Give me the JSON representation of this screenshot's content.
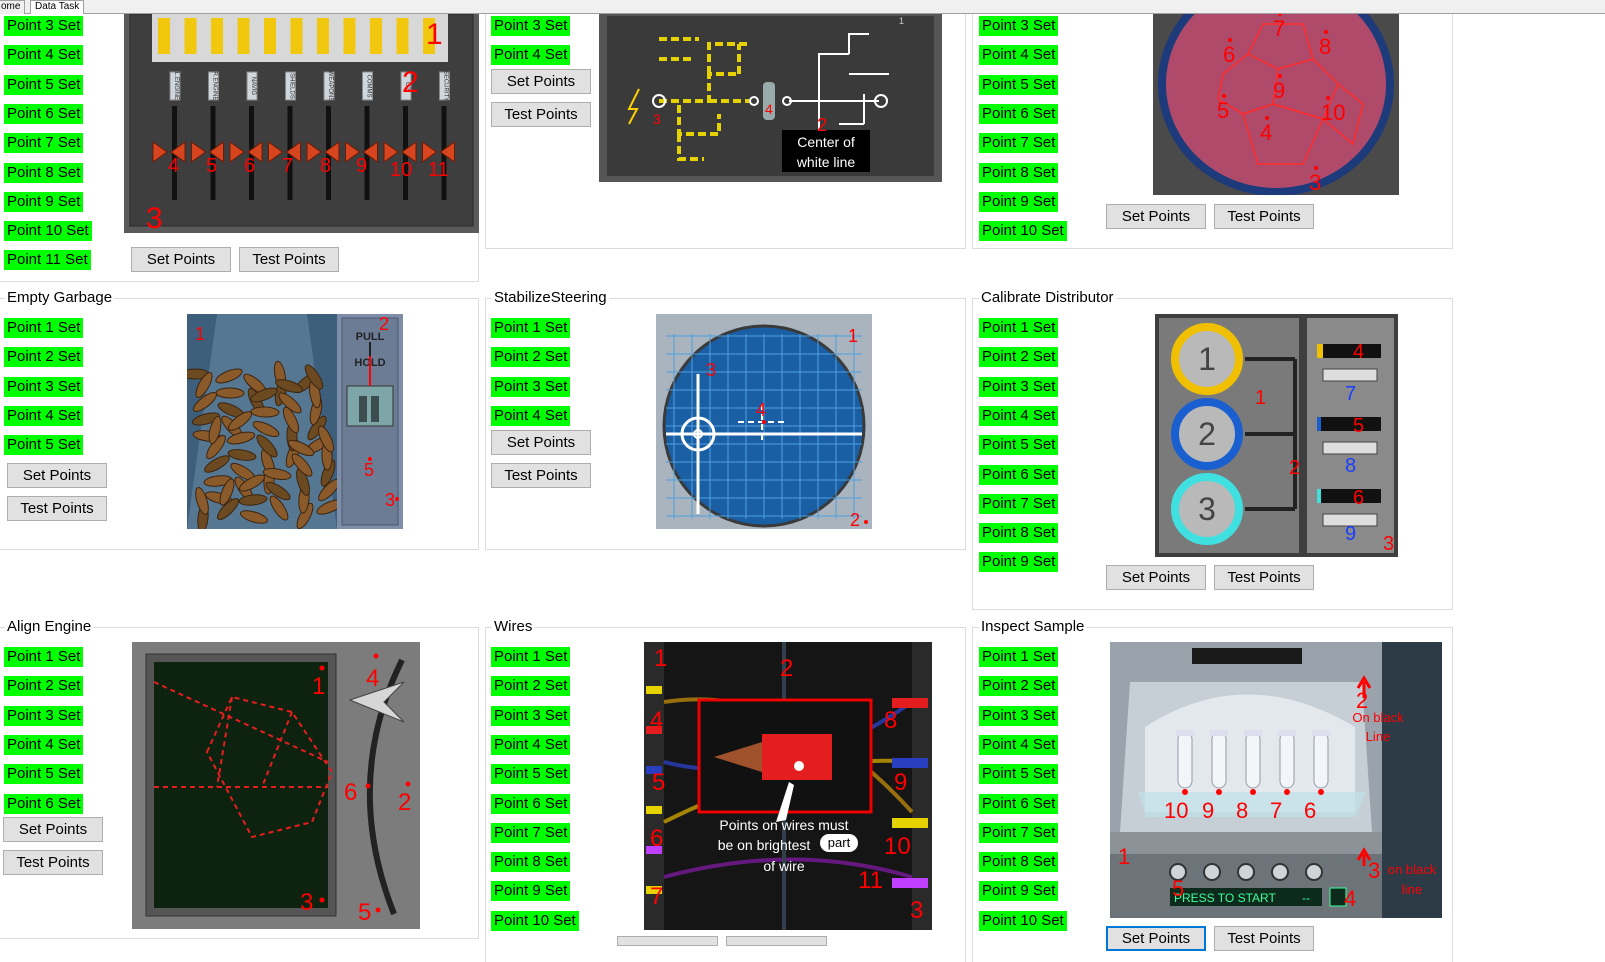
{
  "tabs": [
    {
      "label": "ome"
    },
    {
      "label": "Data Task"
    }
  ],
  "panels": {
    "reactor": {
      "points": [
        "Point 3 Set",
        "Point 4 Set",
        "Point 5 Set",
        "Point 6 Set",
        "Point 7 Set",
        "Point 8 Set",
        "Point 9 Set",
        "Point 10 Set",
        "Point 11 Set"
      ],
      "set_label": "Set Points",
      "test_label": "Test Points",
      "markers": [
        "1",
        "2",
        "3",
        "4",
        "5",
        "6",
        "7",
        "8",
        "9",
        "10",
        "11"
      ],
      "slider_labels": [
        "L.ENGINE",
        "R.ENGINE",
        "NAVIG",
        "SHIELDS",
        "WEAPONS",
        "COMMS",
        "O2",
        "SECURITY"
      ]
    },
    "electrical": {
      "points": [
        "Point 3 Set",
        "Point 4 Set"
      ],
      "set_label": "Set Points",
      "test_label": "Test Points",
      "markers": [
        "1",
        "2",
        "3",
        "4"
      ],
      "callout": [
        "Center of",
        "white line"
      ]
    },
    "asteroids": {
      "points": [
        "Point 3 Set",
        "Point 4 Set",
        "Point 5 Set",
        "Point 6 Set",
        "Point 7 Set",
        "Point 8 Set",
        "Point 9 Set",
        "Point 10 Set"
      ],
      "set_label": "Set Points",
      "test_label": "Test Points",
      "markers": [
        "3",
        "4",
        "5",
        "6",
        "7",
        "8",
        "9",
        "10"
      ]
    },
    "garbage": {
      "title": "Empty Garbage",
      "points": [
        "Point 1 Set",
        "Point 2 Set",
        "Point 3 Set",
        "Point 4 Set",
        "Point 5 Set"
      ],
      "set_label": "Set Points",
      "test_label": "Test Points",
      "markers": [
        "1",
        "2",
        "3",
        "5"
      ],
      "lever_text": [
        "PULL",
        "HOLD"
      ]
    },
    "steering": {
      "title": "StabilizeSteering",
      "points": [
        "Point 1 Set",
        "Point 2 Set",
        "Point 3 Set",
        "Point 4 Set"
      ],
      "set_label": "Set Points",
      "test_label": "Test Points",
      "markers": [
        "1",
        "2",
        "3",
        "4"
      ]
    },
    "distributor": {
      "title": "Calibrate Distributor",
      "points": [
        "Point 1 Set",
        "Point 2 Set",
        "Point 3 Set",
        "Point 4 Set",
        "Point 5 Set",
        "Point 6 Set",
        "Point 7 Set",
        "Point 8 Set",
        "Point 9 Set"
      ],
      "set_label": "Set Points",
      "test_label": "Test Points",
      "markers": [
        "1",
        "2",
        "3",
        "4",
        "5",
        "6",
        "7",
        "8",
        "9"
      ]
    },
    "engine": {
      "title": "Align Engine",
      "points": [
        "Point 1 Set",
        "Point 2 Set",
        "Point 3 Set",
        "Point 4 Set",
        "Point 5 Set",
        "Point 6 Set"
      ],
      "set_label": "Set Points",
      "test_label": "Test Points",
      "markers": [
        "1",
        "2",
        "3",
        "4",
        "5",
        "6"
      ]
    },
    "wires": {
      "title": "Wires",
      "points": [
        "Point 1 Set",
        "Point 2 Set",
        "Point 3 Set",
        "Point 4 Set",
        "Point 5 Set",
        "Point 6 Set",
        "Point 7 Set",
        "Point 8 Set",
        "Point 9 Set",
        "Point 10 Set"
      ],
      "markers": [
        "1",
        "2",
        "3",
        "4",
        "5",
        "6",
        "7",
        "8",
        "9",
        "10",
        "11"
      ],
      "note": [
        "Points on wires must",
        "be on brightest",
        "part",
        "of wire"
      ]
    },
    "sample": {
      "title": "Inspect Sample",
      "points": [
        "Point 1 Set",
        "Point 2 Set",
        "Point 3 Set",
        "Point 4 Set",
        "Point 5 Set",
        "Point 6 Set",
        "Point 7 Set",
        "Point 8 Set",
        "Point 9 Set",
        "Point 10 Set"
      ],
      "set_label": "Set Points",
      "test_label": "Test Points",
      "markers": [
        "1",
        "2",
        "3",
        "4",
        "5",
        "6",
        "7",
        "8",
        "9",
        "10"
      ],
      "note_2": [
        "On black",
        "Line"
      ],
      "note_3": [
        "on black",
        "line"
      ],
      "screen_text": "PRESS TO START",
      "screen_value": "--"
    }
  },
  "colors": {
    "point_bg": "#00ff00",
    "marker": "#ff0000",
    "button": "#e1e1e1"
  }
}
